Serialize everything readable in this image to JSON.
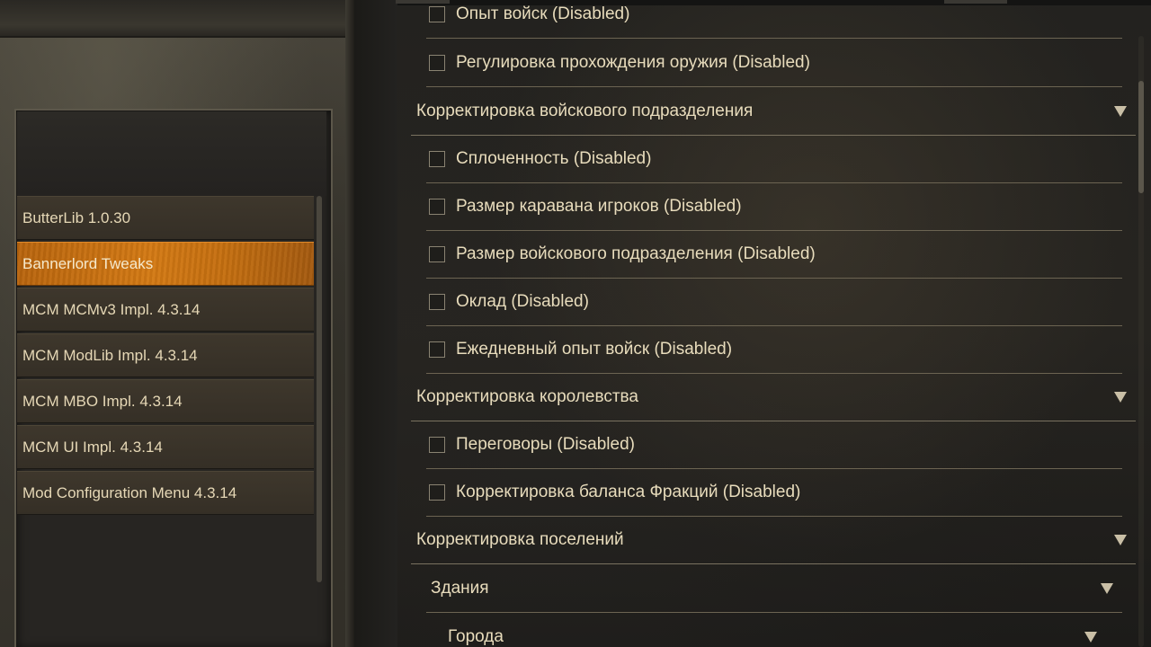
{
  "mod_list": {
    "items": [
      {
        "label": "ButterLib 1.0.30",
        "selected": false
      },
      {
        "label": "Bannerlord Tweaks",
        "selected": true
      },
      {
        "label": "MCM MCMv3 Impl. 4.3.14",
        "selected": false
      },
      {
        "label": "MCM ModLib Impl. 4.3.14",
        "selected": false
      },
      {
        "label": "MCM MBO Impl. 4.3.14",
        "selected": false
      },
      {
        "label": "MCM UI Impl. 4.3.14",
        "selected": false
      },
      {
        "label": "Mod Configuration Menu 4.3.14",
        "selected": false
      }
    ]
  },
  "settings": {
    "opt_troop_xp": "Опыт войск (Disabled)",
    "opt_weapon_cut": "Регулировка прохождения оружия (Disabled)",
    "group_party": "Корректировка войскового подразделения",
    "opt_cohesion": "Сплоченность (Disabled)",
    "opt_caravan_size": "Размер каравана игроков (Disabled)",
    "opt_party_size": "Размер войскового подразделения (Disabled)",
    "opt_wages": "Оклад (Disabled)",
    "opt_daily_xp": "Ежедневный опыт войск (Disabled)",
    "group_kingdom": "Корректировка королевства",
    "opt_diplomacy": "Переговоры (Disabled)",
    "opt_faction_balance": "Корректировка баланса Фракций (Disabled)",
    "group_settlements": "Корректировка поселений",
    "subgroup_buildings": "Здания",
    "subgroup_towns": "Города"
  },
  "colors": {
    "accent_selected": "#d47a14",
    "text": "#e8dcbc"
  }
}
